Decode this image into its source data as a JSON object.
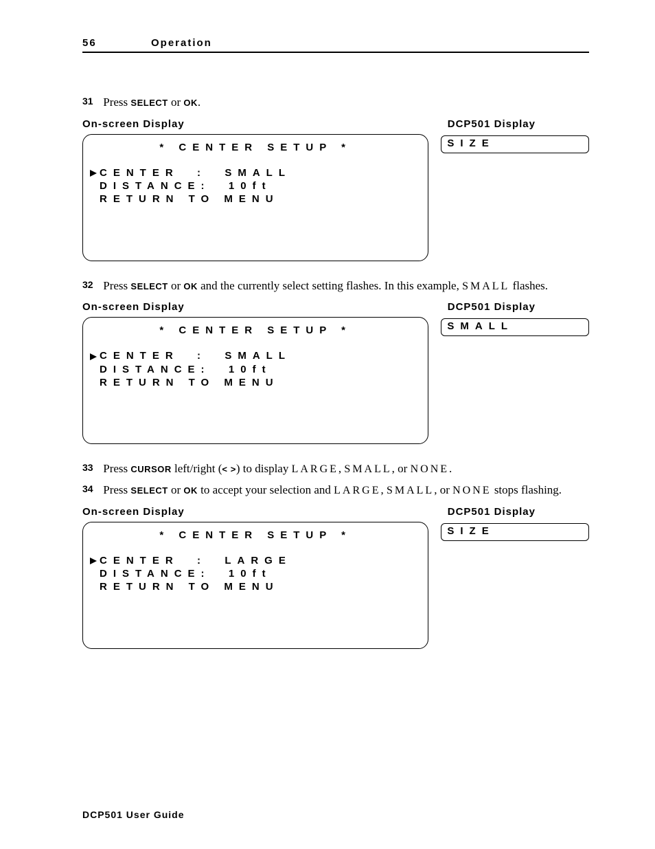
{
  "header": {
    "page_number": "56",
    "section": "Operation"
  },
  "footer": "DCP501 User Guide",
  "labels": {
    "osd": "On-screen Display",
    "dcp": "DCP501 Display"
  },
  "steps": {
    "s31": {
      "num": "31",
      "t1": "Press ",
      "select": "SELECT",
      "t2": " or ",
      "ok": "OK",
      "t3": "."
    },
    "s32": {
      "num": "32",
      "t1": "Press ",
      "select": "SELECT",
      "t2": " or ",
      "ok": "OK",
      "t3": " and the currently select setting flashes. In this example, ",
      "word": "SMALL",
      "t4": " flashes."
    },
    "s33": {
      "num": "33",
      "t1": "Press ",
      "cursor": "CURSOR",
      "t2": " left/right (",
      "lt": "<",
      "gt": ">",
      "t3": ") to display ",
      "w1": "LARGE",
      "c1": ", ",
      "w2": "SMALL",
      "c2": ", or ",
      "w3": "NONE",
      "t4": "."
    },
    "s34": {
      "num": "34",
      "t1": "Press ",
      "select": "SELECT",
      "t2": " or ",
      "ok": "OK",
      "t3": " to accept your selection and ",
      "w1": "LARGE",
      "c1": ", ",
      "w2": "SMALL",
      "c2": ", or ",
      "w3": "NONE",
      "t4": " stops flashing."
    }
  },
  "osd_title": "* CENTER SETUP *",
  "osd1": {
    "l1a": "CENTER  :",
    "l1b": "SMALL",
    "l2a": "DISTANCE:",
    "l2b": "10ft",
    "l3": "RETURN TO MENU"
  },
  "osd2": {
    "l1a": "CENTER  :",
    "l1b": "SMALL",
    "l2a": "DISTANCE:",
    "l2b": "10ft",
    "l3": "RETURN TO MENU"
  },
  "osd3": {
    "l1a": "CENTER  :",
    "l1b": "LARGE",
    "l2a": "DISTANCE:",
    "l2b": "10ft",
    "l3": "RETURN TO MENU"
  },
  "dcp1": "SIZE",
  "dcp2": "SMALL",
  "dcp3": "SIZE"
}
